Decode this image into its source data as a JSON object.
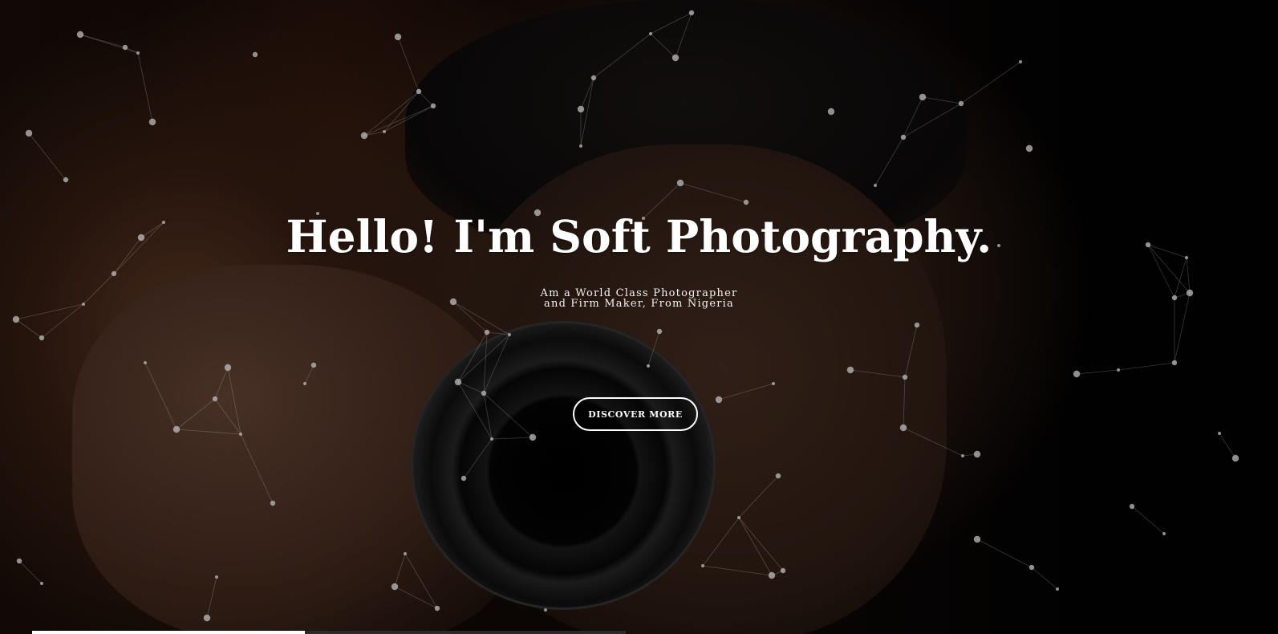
{
  "hero": {
    "headline": "Hello! I'm Soft Photography.",
    "subtitle_line1": "Am a World Class Photographer",
    "subtitle_line2": "and Firm Maker, From Nigeria",
    "cta_label": "DISCOVER MORE",
    "background_image_description": "",
    "slider_progress": 0.46
  },
  "icons": {
    "background": "particle-network"
  },
  "colors": {
    "text": "#ffffff",
    "button_border": "#ffffff",
    "particle": "#bdbdbd"
  }
}
